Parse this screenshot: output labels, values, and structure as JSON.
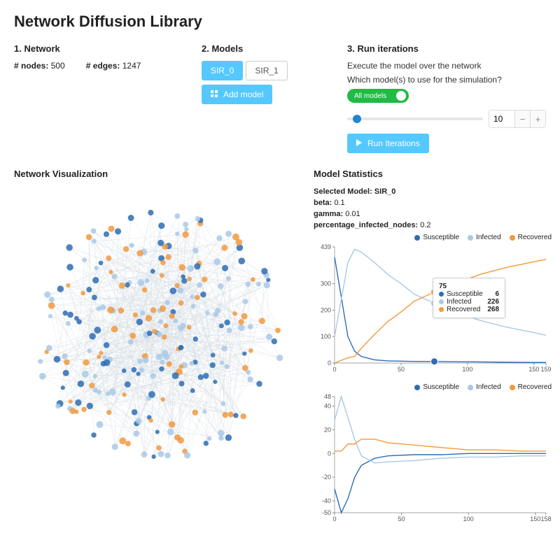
{
  "colors": {
    "susceptible": "#2e6db3",
    "infected": "#a9c9e6",
    "recovered": "#f2993f",
    "primary": "#54c8ff",
    "toggle": "#21ba45"
  },
  "title": "Network Diffusion Library",
  "network": {
    "heading": "1. Network",
    "nodes_label": "# nodes:",
    "nodes": "500",
    "edges_label": "# edges:",
    "edges": "1247"
  },
  "models": {
    "heading": "2. Models",
    "tabs": [
      {
        "label": "SIR_0",
        "active": true
      },
      {
        "label": "SIR_1",
        "active": false
      }
    ],
    "add_label": "Add model"
  },
  "run": {
    "heading": "3. Run iterations",
    "desc": "Execute the model over the network",
    "question": "Which model(s) to use for the simulation?",
    "toggle_label": "All models",
    "iterations_value": "10",
    "run_label": "Run Iterations"
  },
  "vis": {
    "heading": "Network Visualization"
  },
  "stats": {
    "heading": "Model Statistics",
    "selected_label": "Selected Model: SIR_0",
    "params": [
      {
        "name": "beta:",
        "value": "0.1"
      },
      {
        "name": "gamma:",
        "value": "0.01"
      },
      {
        "name": "percentage_infected_nodes:",
        "value": "0.2"
      }
    ],
    "legend": {
      "susceptible": "Susceptible",
      "infected": "Infected",
      "recovered": "Recovered"
    }
  },
  "tooltip": {
    "x": "75",
    "rows": [
      {
        "label": "Susceptible",
        "value": "6",
        "color": "#2e6db3"
      },
      {
        "label": "Infected",
        "value": "226",
        "color": "#a9c9e6"
      },
      {
        "label": "Recovered",
        "value": "268",
        "color": "#f2993f"
      }
    ]
  },
  "chart_data": [
    {
      "type": "line",
      "title": "",
      "xlabel": "",
      "ylabel": "",
      "xlim": [
        0,
        159
      ],
      "ylim": [
        0,
        439
      ],
      "yticks": [
        0,
        100,
        200,
        300,
        439
      ],
      "xticks": [
        0,
        50,
        100,
        150,
        159
      ],
      "x": [
        0,
        5,
        10,
        15,
        20,
        30,
        40,
        50,
        60,
        75,
        90,
        110,
        130,
        150,
        159
      ],
      "series": [
        {
          "name": "Susceptible",
          "color": "#2e6db3",
          "values": [
            400,
            250,
            100,
            45,
            25,
            12,
            8,
            7,
            6,
            6,
            5,
            4,
            3,
            2,
            2
          ]
        },
        {
          "name": "Infected",
          "color": "#a9c9e6",
          "values": [
            100,
            240,
            380,
            430,
            420,
            380,
            335,
            300,
            260,
            226,
            195,
            160,
            135,
            115,
            105
          ]
        },
        {
          "name": "Recovered",
          "color": "#f2993f",
          "values": [
            0,
            10,
            20,
            25,
            55,
            108,
            157,
            193,
            234,
            268,
            300,
            336,
            362,
            383,
            392
          ]
        }
      ],
      "marker_x": 75
    },
    {
      "type": "line",
      "title": "",
      "xlabel": "",
      "ylabel": "",
      "xlim": [
        0,
        158
      ],
      "ylim": [
        -50,
        48
      ],
      "yticks": [
        -50,
        -40,
        -20,
        0,
        20,
        40,
        48
      ],
      "xticks": [
        0,
        50,
        100,
        150,
        158
      ],
      "x": [
        0,
        5,
        10,
        15,
        20,
        30,
        40,
        60,
        80,
        100,
        120,
        140,
        158
      ],
      "series": [
        {
          "name": "Susceptible",
          "color": "#2e6db3",
          "values": [
            -30,
            -50,
            -38,
            -20,
            -10,
            -4,
            -2,
            -1,
            -1,
            0,
            0,
            0,
            0
          ]
        },
        {
          "name": "Infected",
          "color": "#a9c9e6",
          "values": [
            28,
            48,
            30,
            12,
            -2,
            -8,
            -7,
            -6,
            -4,
            -3,
            -3,
            -2,
            -2
          ]
        },
        {
          "name": "Recovered",
          "color": "#f2993f",
          "values": [
            2,
            2,
            8,
            8,
            12,
            12,
            9,
            7,
            5,
            3,
            3,
            2,
            2
          ]
        }
      ]
    }
  ]
}
